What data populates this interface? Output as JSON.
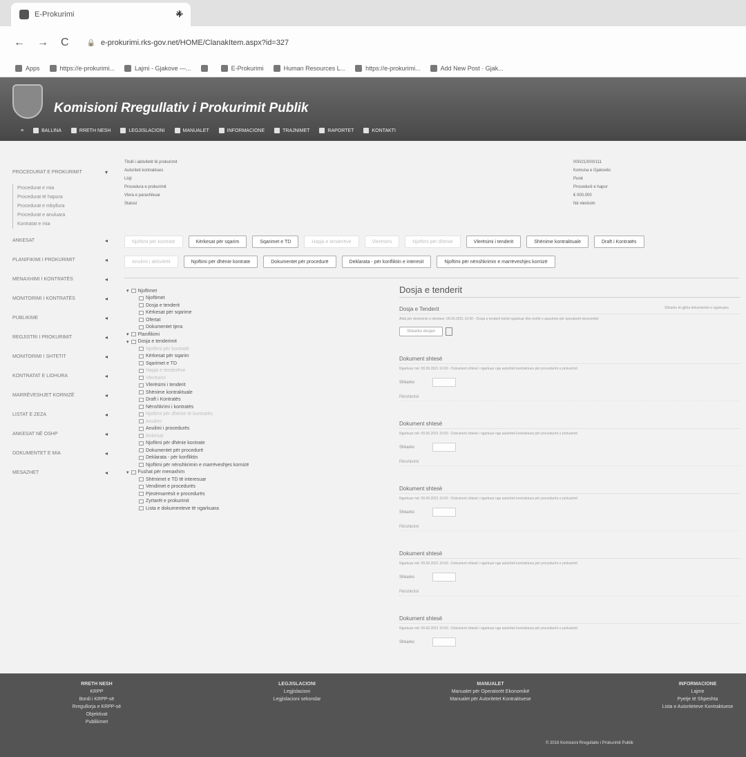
{
  "browser": {
    "tab_title": "E-Prokurimi",
    "tab_close": "×",
    "new_tab": "+",
    "back": "←",
    "forward": "→",
    "reload": "C",
    "url": "e-prokurimi.rks-gov.net/HOME/ClanakItem.aspx?id=327",
    "bookmarks": [
      "Apps",
      "https://e-prokurimi...",
      "Lajmi - Gjakove —...",
      "",
      "E-Prokurimi",
      "Human Resources L...",
      "https://e-prokurimi...",
      "Add New Post · Gjak..."
    ]
  },
  "site": {
    "title": "Komisioni Rregullativ i Prokurimit Publik",
    "nav": [
      "Ballina",
      "Rreth nesh",
      "Legjislacioni",
      "Manualet",
      "Informacione",
      "Trajnimet",
      "Raportet",
      "Kontakti"
    ]
  },
  "sidebar": {
    "items": [
      {
        "label": "Procedurat e prokurimit",
        "caret": "▾"
      },
      {
        "label": "Ankesat",
        "caret": "◂"
      },
      {
        "label": "Planifikimi i prokurimit",
        "caret": "◂"
      },
      {
        "label": "Menaxhimi i kontratës",
        "caret": "◂"
      },
      {
        "label": "Monitorimi i kontratës",
        "caret": "◂"
      },
      {
        "label": "Publikime",
        "caret": "◂"
      },
      {
        "label": "Regjistri i prokurimit",
        "caret": "◂"
      },
      {
        "label": "Monitorimi i shtetit",
        "caret": "◂"
      },
      {
        "label": "Kontratat e lidhura",
        "caret": "◂"
      },
      {
        "label": "Marrëveshjet kornizë",
        "caret": "◂"
      },
      {
        "label": "Listat e zeza",
        "caret": "◂"
      },
      {
        "label": "Ankesat në OSHP",
        "caret": "◂"
      },
      {
        "label": "Dokumentet e mia",
        "caret": "◂"
      },
      {
        "label": "Mesazhet",
        "caret": "◂"
      }
    ],
    "subitems": [
      "Procedurat e mia",
      "Procedurat të hapura",
      "Procedurat e mbyllura",
      "Procedurat e anuluara",
      "Kontratat e mia"
    ]
  },
  "info": {
    "rows": [
      {
        "k": "Titulli i aktivitetit të prokurimit",
        "v": "000/21/000/111"
      },
      {
        "k": "Autoriteti kontraktues",
        "v": "Komuna e Gjakovës"
      },
      {
        "k": "Lloji",
        "v": "Punë"
      },
      {
        "k": "Procedura e prokurimit",
        "v": "Procedurë e hapur"
      },
      {
        "k": "Vlera e parashikuar",
        "v": "€ 000.000"
      },
      {
        "k": "Statusi",
        "v": "Në vlerësim"
      }
    ]
  },
  "buttons_row1": [
    {
      "label": "Njoftimi për kontratë",
      "faded": true
    },
    {
      "label": "Kërkesat për sqarim",
      "faded": false
    },
    {
      "label": "Sqarimet e TD",
      "faded": false
    },
    {
      "label": "Hapja e tenderëve",
      "faded": true
    },
    {
      "label": "Vlerësimi",
      "faded": true
    },
    {
      "label": "Njoftimi për dhënie",
      "faded": true
    },
    {
      "label": "Vlerësimi i tenderit",
      "faded": false
    },
    {
      "label": "Shënime kontraktuale",
      "faded": false
    },
    {
      "label": "Draft i Kontratës",
      "faded": false
    }
  ],
  "buttons_row2": [
    {
      "label": "Anulimi i aktivitetit",
      "faded": true
    },
    {
      "label": "Njoftimi për dhënie kontrate",
      "faded": false
    },
    {
      "label": "Dokumentet për procedurë",
      "faded": false
    },
    {
      "label": "Deklarata - për konfliktin e interesit",
      "faded": false
    },
    {
      "label": "Njoftimi për nënshkrimin e marrëveshjes kornizë",
      "faded": false
    }
  ],
  "tree": [
    {
      "label": "Njoftimet",
      "indent": 0,
      "faded": false
    },
    {
      "label": "Njoftimet",
      "indent": 1,
      "faded": false
    },
    {
      "label": "Dosja e tenderit",
      "indent": 1,
      "faded": false
    },
    {
      "label": "Kërkesat për sqarime",
      "indent": 1,
      "faded": false
    },
    {
      "label": "Ofertat",
      "indent": 1,
      "faded": false
    },
    {
      "label": "Dokumentet tjera",
      "indent": 1,
      "faded": false
    },
    {
      "label": "Planifikimi",
      "indent": 0,
      "faded": false
    },
    {
      "label": "Dosja e tenderimit",
      "indent": 0,
      "faded": false
    },
    {
      "label": "Njoftimi për kontratë",
      "indent": 1,
      "faded": true
    },
    {
      "label": "Kërkesat për sqarim",
      "indent": 1,
      "faded": false
    },
    {
      "label": "Sqarimet e TD",
      "indent": 1,
      "faded": false
    },
    {
      "label": "Hapja e tenderëve",
      "indent": 1,
      "faded": true
    },
    {
      "label": "Vlerësimi",
      "indent": 1,
      "faded": true
    },
    {
      "label": "Vlerësimi i tenderit",
      "indent": 1,
      "faded": false
    },
    {
      "label": "Shënime kontraktuale",
      "indent": 1,
      "faded": false
    },
    {
      "label": "Draft i Kontratës",
      "indent": 1,
      "faded": false
    },
    {
      "label": "Nënshkrimi i kontratës",
      "indent": 1,
      "faded": false
    },
    {
      "label": "Njoftimi për dhënie të kontratës",
      "indent": 1,
      "faded": true
    },
    {
      "label": "Anulimi",
      "indent": 1,
      "faded": true
    },
    {
      "label": "Anulimi i procedurës",
      "indent": 1,
      "faded": false
    },
    {
      "label": "Ankesat",
      "indent": 1,
      "faded": true
    },
    {
      "label": "Njoftimi për dhënie kontrate",
      "indent": 1,
      "faded": false
    },
    {
      "label": "Dokumentet për procedurë",
      "indent": 1,
      "faded": false
    },
    {
      "label": "Deklarata - për konfliktin",
      "indent": 1,
      "faded": false
    },
    {
      "label": "Njoftimi për nënshkrimin e marrëveshjes kornizë",
      "indent": 1,
      "faded": false
    },
    {
      "label": "Fushat për menaxhim",
      "indent": 0,
      "faded": false
    },
    {
      "label": "Shënimet e TD të interesuar",
      "indent": 1,
      "faded": false
    },
    {
      "label": "Vendimet e procedurës",
      "indent": 1,
      "faded": false
    },
    {
      "label": "Pjesëmarrësit e procedurës",
      "indent": 1,
      "faded": false
    },
    {
      "label": "Zyrtarët e prokurimit",
      "indent": 1,
      "faded": false
    },
    {
      "label": "Lista e dokumenteve të ngarkuara",
      "indent": 1,
      "faded": false
    }
  ],
  "content": {
    "title": "Dosja e tenderit",
    "first_doc": {
      "head": "Dosja e Tenderit",
      "side": "Shkarko të gjitha dokumentet e ngarkuara",
      "sub": "Afati për dorëzimin e ofertave: 00.00.2021 10:00 - Dosja e tenderit është ngarkuar dhe është e qasshme për operatorët ekonomikë",
      "btn": "Shkarko dosjen"
    },
    "docs": [
      {
        "head": "Dokument shtesë",
        "sub": "Ngarkuar më: 00.00.2021 10:00 - Dokument shtesë i ngarkuar nga autoriteti kontraktues për procedurën e prokurimit",
        "file_label": "Shkarko",
        "foot": "Përshkrimi"
      },
      {
        "head": "Dokument shtesë",
        "sub": "Ngarkuar më: 00.00.2021 10:00 - Dokument shtesë i ngarkuar nga autoriteti kontraktues për procedurën e prokurimit",
        "file_label": "Shkarko",
        "foot": "Përshkrimi"
      },
      {
        "head": "Dokument shtesë",
        "sub": "Ngarkuar më: 00.00.2021 10:00 - Dokument shtesë i ngarkuar nga autoriteti kontraktues për procedurën e prokurimit",
        "file_label": "Shkarko",
        "foot": "Përshkrimi"
      },
      {
        "head": "Dokument shtesë",
        "sub": "Ngarkuar më: 00.00.2021 10:00 - Dokument shtesë i ngarkuar nga autoriteti kontraktues për procedurën e prokurimit",
        "file_label": "Shkarko",
        "foot": "Përshkrimi"
      },
      {
        "head": "Dokument shtesë",
        "sub": "Ngarkuar më: 00.00.2021 10:00 - Dokument shtesë i ngarkuar nga autoriteti kontraktues për procedurën e prokurimit",
        "file_label": "Shkarko",
        "foot": ""
      }
    ]
  },
  "footer": {
    "cols": [
      {
        "head": "Rreth nesh",
        "lines": [
          "KRPP",
          "Bordi i KRPP-së",
          "Rregullorja e KRPP-së",
          "Objektivat",
          "Publikimet"
        ]
      },
      {
        "head": "Legjislacioni",
        "lines": [
          "Legjislacioni",
          "Legjislacioni sekondar"
        ]
      },
      {
        "head": "Manualet",
        "lines": [
          "Manualet për Operatorët Ekonomikë",
          "Manualet për Autoritetet Kontraktuese"
        ]
      },
      {
        "head": "Informacione",
        "lines": [
          "Lajme",
          "Pyetje të Shpeshta",
          "Lista e Autoriteteve Kontraktuese"
        ]
      }
    ],
    "copyright": "© 2016 Komisioni Rregullativ i Prokurimit Publik"
  }
}
